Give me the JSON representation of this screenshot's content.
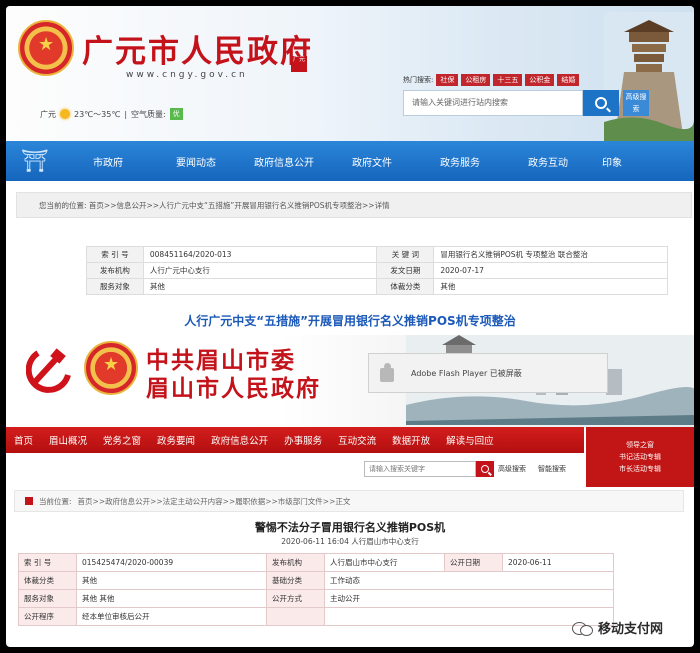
{
  "guangyuan": {
    "site_title": "广元市人民政府",
    "seal_text": "广元",
    "url": "www.cngy.gov.cn",
    "weather": {
      "city": "广元",
      "temp": "23℃～35℃",
      "aqi_label": "空气质量:",
      "aqi_value": "优"
    },
    "hot_label": "热门搜索:",
    "hot_tags": [
      "社保",
      "公租房",
      "十三五",
      "公积金",
      "结婚"
    ],
    "search_placeholder": "请输入关键词进行站内搜索",
    "advanced_search": "高级搜索",
    "nav": [
      "市政府",
      "要闻动态",
      "政府信息公开",
      "政府文件",
      "政务服务",
      "政务互动",
      "印象"
    ],
    "breadcrumb": "您当前的位置: 首页>>信息公开>>人行广元中支“五措施”开展冒用银行名义推销POS机专项整治>>详情",
    "info": [
      {
        "k1": "索 引 号",
        "v1": "008451164/2020-013",
        "k2": "关 键 词",
        "v2": "冒用银行名义推销POS机 专项整治 联合整治"
      },
      {
        "k1": "发布机构",
        "v1": "人行广元中心支行",
        "k2": "发文日期",
        "v2": "2020-07-17"
      },
      {
        "k1": "服务对象",
        "v1": "其他",
        "k2": "体裁分类",
        "v2": "其他"
      }
    ],
    "headline": "人行广元中支“五措施”开展冒用银行名义推销POS机专项整治"
  },
  "meishan": {
    "title_line1": "中共眉山市委",
    "title_line2": "眉山市人民政府",
    "flash_notice": "Adobe Flash Player 已被屏蔽",
    "nav": [
      "首页",
      "眉山概况",
      "党务之窗",
      "政务要闻",
      "政府信息公开",
      "办事服务",
      "互动交流",
      "数据开放",
      "解读与回应"
    ],
    "side_links": [
      "领导之窗",
      "书记活动专辑",
      "市长活动专辑"
    ],
    "search_placeholder": "请输入搜索关键字",
    "advanced_search": "高级搜索",
    "smart_search": "智能搜索",
    "breadcrumb_label": "当前位置:",
    "breadcrumb": "首页>>政府信息公开>>法定主动公开内容>>履职依据>>市级部门文件>>正文",
    "title": "警惕不法分子冒用银行名义推销POS机",
    "subtitle": "2020-06-11 16:04    人行眉山市中心支行",
    "info": [
      {
        "k1": "索  引  号",
        "v1": "015425474/2020-00039",
        "k2": "发布机构",
        "v2": "人行眉山市中心支行",
        "k3": "公开日期",
        "v3": "2020-06-11"
      },
      {
        "k1": "体裁分类",
        "v1": "其他",
        "k2": "基础分类",
        "v2": "工作动态",
        "k3": "",
        "v3": ""
      },
      {
        "k1": "服务对象",
        "v1": "其他 其他",
        "k2": "公开方式",
        "v2": "主动公开",
        "k3": "",
        "v3": ""
      },
      {
        "k1": "公开程序",
        "v1": "经本单位审核后公开",
        "k2": "",
        "v2": "",
        "k3": "",
        "v3": ""
      }
    ]
  },
  "watermark": "移动支付网",
  "colors": {
    "gov_red": "#c4121a",
    "gy_blue": "#1d74c6",
    "ms_nav_red": "#c21616"
  }
}
